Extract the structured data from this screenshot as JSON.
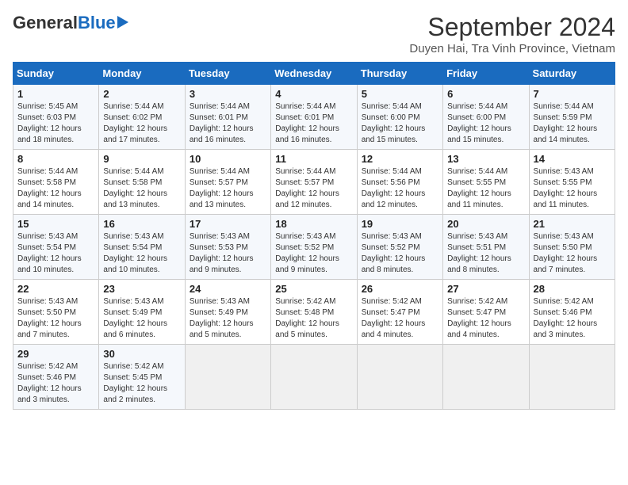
{
  "header": {
    "logo_general": "General",
    "logo_blue": "Blue",
    "title": "September 2024",
    "subtitle": "Duyen Hai, Tra Vinh Province, Vietnam"
  },
  "calendar": {
    "columns": [
      "Sunday",
      "Monday",
      "Tuesday",
      "Wednesday",
      "Thursday",
      "Friday",
      "Saturday"
    ],
    "weeks": [
      [
        {
          "day": 1,
          "sunrise": "5:45 AM",
          "sunset": "6:03 PM",
          "daylight": "12 hours and 18 minutes."
        },
        {
          "day": 2,
          "sunrise": "5:44 AM",
          "sunset": "6:02 PM",
          "daylight": "12 hours and 17 minutes."
        },
        {
          "day": 3,
          "sunrise": "5:44 AM",
          "sunset": "6:01 PM",
          "daylight": "12 hours and 16 minutes."
        },
        {
          "day": 4,
          "sunrise": "5:44 AM",
          "sunset": "6:01 PM",
          "daylight": "12 hours and 16 minutes."
        },
        {
          "day": 5,
          "sunrise": "5:44 AM",
          "sunset": "6:00 PM",
          "daylight": "12 hours and 15 minutes."
        },
        {
          "day": 6,
          "sunrise": "5:44 AM",
          "sunset": "6:00 PM",
          "daylight": "12 hours and 15 minutes."
        },
        {
          "day": 7,
          "sunrise": "5:44 AM",
          "sunset": "5:59 PM",
          "daylight": "12 hours and 14 minutes."
        }
      ],
      [
        {
          "day": 8,
          "sunrise": "5:44 AM",
          "sunset": "5:58 PM",
          "daylight": "12 hours and 14 minutes."
        },
        {
          "day": 9,
          "sunrise": "5:44 AM",
          "sunset": "5:58 PM",
          "daylight": "12 hours and 13 minutes."
        },
        {
          "day": 10,
          "sunrise": "5:44 AM",
          "sunset": "5:57 PM",
          "daylight": "12 hours and 13 minutes."
        },
        {
          "day": 11,
          "sunrise": "5:44 AM",
          "sunset": "5:57 PM",
          "daylight": "12 hours and 12 minutes."
        },
        {
          "day": 12,
          "sunrise": "5:44 AM",
          "sunset": "5:56 PM",
          "daylight": "12 hours and 12 minutes."
        },
        {
          "day": 13,
          "sunrise": "5:44 AM",
          "sunset": "5:55 PM",
          "daylight": "12 hours and 11 minutes."
        },
        {
          "day": 14,
          "sunrise": "5:43 AM",
          "sunset": "5:55 PM",
          "daylight": "12 hours and 11 minutes."
        }
      ],
      [
        {
          "day": 15,
          "sunrise": "5:43 AM",
          "sunset": "5:54 PM",
          "daylight": "12 hours and 10 minutes."
        },
        {
          "day": 16,
          "sunrise": "5:43 AM",
          "sunset": "5:54 PM",
          "daylight": "12 hours and 10 minutes."
        },
        {
          "day": 17,
          "sunrise": "5:43 AM",
          "sunset": "5:53 PM",
          "daylight": "12 hours and 9 minutes."
        },
        {
          "day": 18,
          "sunrise": "5:43 AM",
          "sunset": "5:52 PM",
          "daylight": "12 hours and 9 minutes."
        },
        {
          "day": 19,
          "sunrise": "5:43 AM",
          "sunset": "5:52 PM",
          "daylight": "12 hours and 8 minutes."
        },
        {
          "day": 20,
          "sunrise": "5:43 AM",
          "sunset": "5:51 PM",
          "daylight": "12 hours and 8 minutes."
        },
        {
          "day": 21,
          "sunrise": "5:43 AM",
          "sunset": "5:50 PM",
          "daylight": "12 hours and 7 minutes."
        }
      ],
      [
        {
          "day": 22,
          "sunrise": "5:43 AM",
          "sunset": "5:50 PM",
          "daylight": "12 hours and 7 minutes."
        },
        {
          "day": 23,
          "sunrise": "5:43 AM",
          "sunset": "5:49 PM",
          "daylight": "12 hours and 6 minutes."
        },
        {
          "day": 24,
          "sunrise": "5:43 AM",
          "sunset": "5:49 PM",
          "daylight": "12 hours and 5 minutes."
        },
        {
          "day": 25,
          "sunrise": "5:42 AM",
          "sunset": "5:48 PM",
          "daylight": "12 hours and 5 minutes."
        },
        {
          "day": 26,
          "sunrise": "5:42 AM",
          "sunset": "5:47 PM",
          "daylight": "12 hours and 4 minutes."
        },
        {
          "day": 27,
          "sunrise": "5:42 AM",
          "sunset": "5:47 PM",
          "daylight": "12 hours and 4 minutes."
        },
        {
          "day": 28,
          "sunrise": "5:42 AM",
          "sunset": "5:46 PM",
          "daylight": "12 hours and 3 minutes."
        }
      ],
      [
        {
          "day": 29,
          "sunrise": "5:42 AM",
          "sunset": "5:46 PM",
          "daylight": "12 hours and 3 minutes."
        },
        {
          "day": 30,
          "sunrise": "5:42 AM",
          "sunset": "5:45 PM",
          "daylight": "12 hours and 2 minutes."
        },
        null,
        null,
        null,
        null,
        null
      ]
    ]
  }
}
